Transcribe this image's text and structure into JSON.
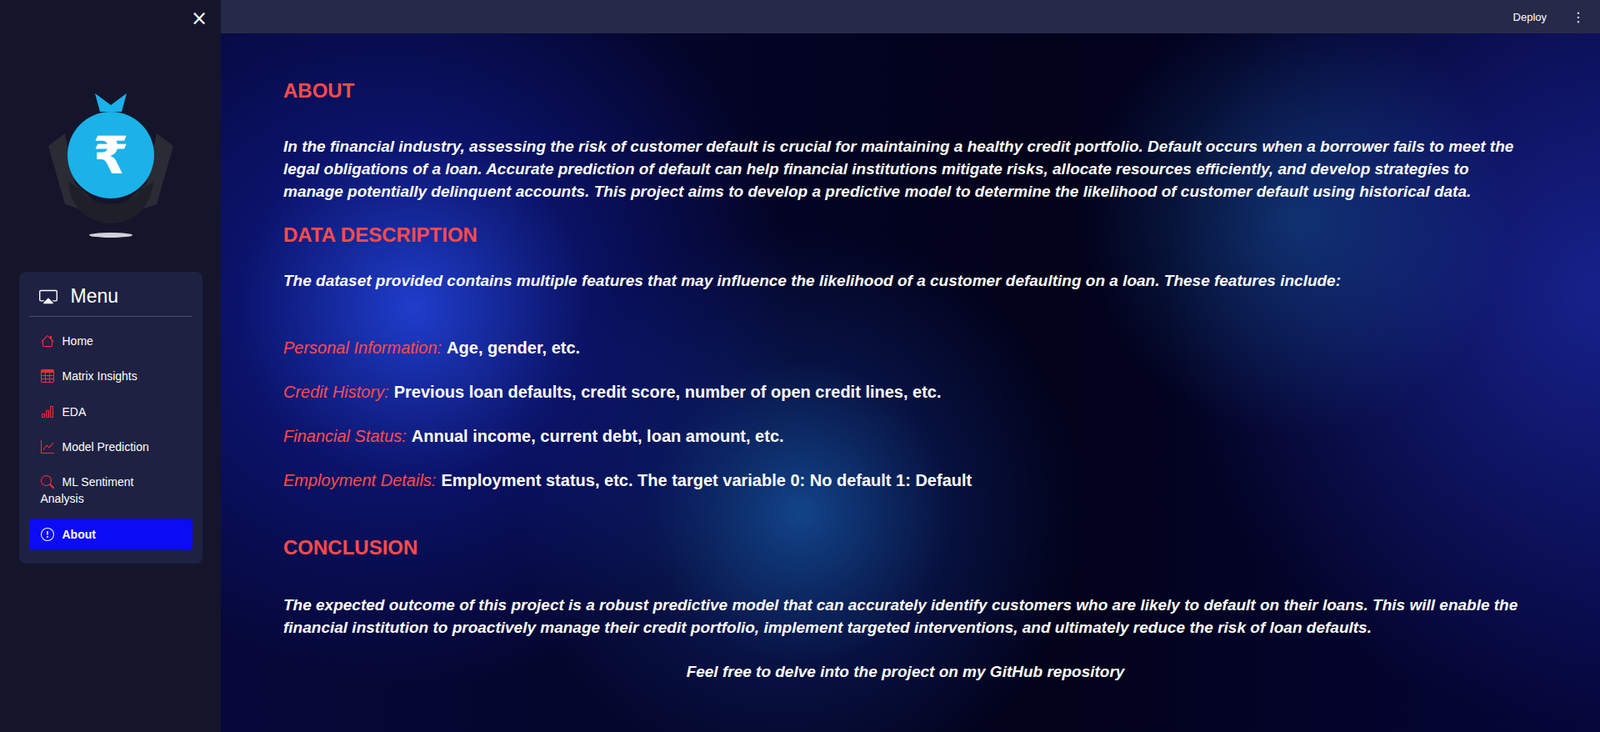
{
  "header": {
    "deploy": "Deploy",
    "more_icon": "⋮"
  },
  "sidebar": {
    "close": "×",
    "logo_symbol": "₹",
    "menu_title": "Menu",
    "items": [
      {
        "label": "Home",
        "selected": false
      },
      {
        "label": "Matrix Insights",
        "selected": false
      },
      {
        "label": "EDA",
        "selected": false
      },
      {
        "label": "Model Prediction",
        "selected": false
      },
      {
        "label": "ML Sentiment Analysis",
        "selected": false
      },
      {
        "label": "About",
        "selected": true
      }
    ]
  },
  "about": {
    "title": "ABOUT",
    "text": "In the financial industry, assessing the risk of customer default is crucial for maintaining a healthy credit portfolio. Default occurs when a borrower fails to meet the legal obligations of a loan. Accurate prediction of default can help financial institutions mitigate risks, allocate resources efficiently, and develop strategies to manage potentially delinquent accounts. This project aims to develop a predictive model to determine the likelihood of customer default using historical data."
  },
  "data_description": {
    "title": "DATA DESCRIPTION",
    "intro": "The dataset provided contains multiple features that may influence the likelihood of a customer defaulting on a loan. These features include:",
    "features": [
      {
        "label": "Personal Information:",
        "text": "Age, gender, etc."
      },
      {
        "label": "Credit History:",
        "text": "Previous loan defaults, credit score, number of open credit lines, etc."
      },
      {
        "label": "Financial Status:",
        "text": "Annual income, current debt, loan amount, etc."
      },
      {
        "label": "Employment Details:",
        "text": "Employment status, etc. The target variable 0: No default 1: Default"
      }
    ]
  },
  "conclusion": {
    "title": "CONCLUSION",
    "text": "The expected outcome of this project is a robust predictive model that can accurately identify customers who are likely to default on their loans. This will enable the financial institution to proactively manage their credit portfolio, implement targeted interventions, and ultimately reduce the risk of loan defaults."
  },
  "footer": "Feel free to delve into the project on my GitHub repository"
}
